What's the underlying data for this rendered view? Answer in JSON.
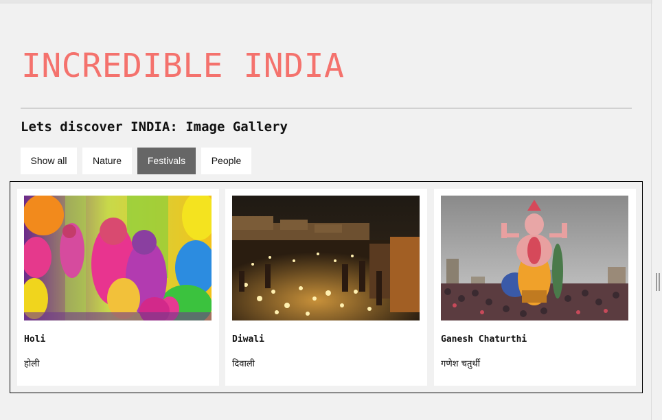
{
  "header": {
    "title": "INCREDIBLE INDIA",
    "subtitle": "Lets discover INDIA: Image Gallery"
  },
  "filters": [
    {
      "label": "Show all",
      "active": false
    },
    {
      "label": "Nature",
      "active": false
    },
    {
      "label": "Festivals",
      "active": true
    },
    {
      "label": "People",
      "active": false
    }
  ],
  "gallery": [
    {
      "title": "Holi",
      "subtitle": "होली",
      "image": "holi-photo"
    },
    {
      "title": "Diwali",
      "subtitle": "दिवाली",
      "image": "diwali-photo"
    },
    {
      "title": "Ganesh Chaturthi",
      "subtitle": "गणेश चतुर्थी",
      "image": "ganesh-chaturthi-photo"
    }
  ],
  "colors": {
    "title": "#f4726d",
    "page_background": "#f1f1f1",
    "active_filter": "#666666"
  }
}
